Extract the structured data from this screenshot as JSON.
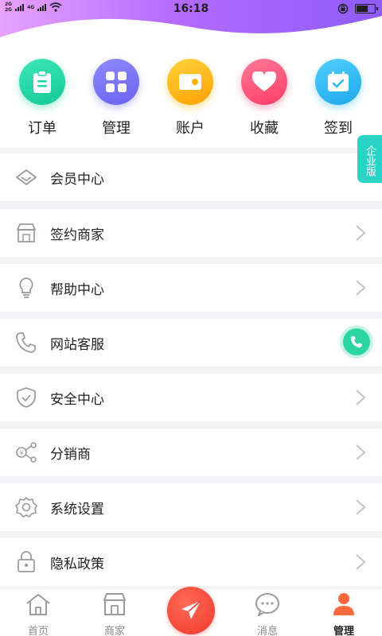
{
  "status_bar": {
    "net_top": "2G",
    "net_top_2": "4G",
    "net_bottom": "2G",
    "time": "16:18"
  },
  "quick_actions": [
    {
      "label": "订单",
      "icon": "clipboard-icon",
      "color": "#20d6a3"
    },
    {
      "label": "管理",
      "icon": "grid-icon",
      "color": "#7b74f5"
    },
    {
      "label": "账户",
      "icon": "wallet-icon",
      "color": "#ffb400"
    },
    {
      "label": "收藏",
      "icon": "heart-icon",
      "color": "#ff4d73"
    },
    {
      "label": "签到",
      "icon": "calendar-check-icon",
      "color": "#2bb8f0"
    }
  ],
  "side_tab": {
    "label": "企业版"
  },
  "menu": [
    {
      "label": "会员中心",
      "icon": "diamond-icon"
    },
    {
      "label": "签约商家",
      "icon": "store-icon"
    },
    {
      "label": "帮助中心",
      "icon": "lightbulb-icon"
    },
    {
      "label": "网站客服",
      "icon": "phone-icon"
    },
    {
      "label": "安全中心",
      "icon": "shield-check-icon"
    },
    {
      "label": "分销商",
      "icon": "share-yen-icon"
    },
    {
      "label": "系统设置",
      "icon": "gear-icon"
    },
    {
      "label": "隐私政策",
      "icon": "lock-icon"
    }
  ],
  "tabbar": {
    "items": [
      {
        "label": "首页",
        "icon": "home-icon",
        "active": false
      },
      {
        "label": "商家",
        "icon": "store-icon",
        "active": false
      },
      {
        "label": "",
        "icon": "paper-plane-icon",
        "active": false
      },
      {
        "label": "消息",
        "icon": "chat-bubble-icon",
        "active": false
      },
      {
        "label": "管理",
        "icon": "user-icon",
        "active": true
      }
    ]
  },
  "colors": {
    "header_gradient": [
      "#e8a3ff",
      "#8e5cf7"
    ],
    "side_tab": "#29d3c6",
    "float_phone": "#2bd6a1",
    "center_button": "#f0382b",
    "active_user": "#ff6a3d"
  }
}
